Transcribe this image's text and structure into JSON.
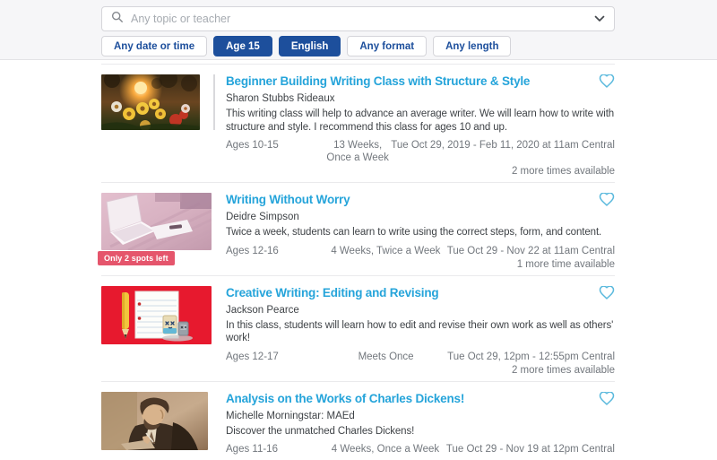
{
  "colors": {
    "accent_blue": "#1d4f9c",
    "title_blue": "#25a4da",
    "heart_blue": "#5ab9dd",
    "badge_red": "#e5556c",
    "text_dark": "#3f4347",
    "text_gray": "#72777d",
    "topbar_bg": "#f6f6f8"
  },
  "search": {
    "placeholder": "Any topic or teacher"
  },
  "filters": [
    {
      "label": "Any date or time",
      "active": false
    },
    {
      "label": "Age 15",
      "active": true
    },
    {
      "label": "English",
      "active": true
    },
    {
      "label": "Any format",
      "active": false
    },
    {
      "label": "Any length",
      "active": false
    }
  ],
  "classes": [
    {
      "title": "Beginner Building Writing Class with Structure & Style",
      "teacher": "Sharon Stubbs Rideaux",
      "description": "This writing class will help to advance an average writer. We will learn how to write with structure and style. I recommend this class for ages 10 and up.",
      "ages": "Ages 10-15",
      "frequency": "13 Weeks, Once a Week",
      "time": "Tue Oct 29, 2019 - Feb 11, 2020 at 11am Central",
      "more": "2 more times available",
      "badge": ""
    },
    {
      "title": "Writing Without Worry",
      "teacher": "Deidre Simpson",
      "description": "Twice a week, students can learn to write using the correct steps, form, and content.",
      "ages": "Ages 12-16",
      "frequency": "4 Weeks, Twice a Week",
      "time": "Tue Oct 29 - Nov 22 at 11am Central",
      "more": "1 more time available",
      "badge": "Only 2 spots left"
    },
    {
      "title": "Creative Writing: Editing and Revising",
      "teacher": "Jackson Pearce",
      "description": "In this class, students will learn how to edit and revise their own work as well as others' work!",
      "ages": "Ages 12-17",
      "frequency": "Meets Once",
      "time": "Tue Oct 29, 12pm - 12:55pm Central",
      "more": "2 more times available",
      "badge": ""
    },
    {
      "title": "Analysis on the Works of Charles Dickens!",
      "teacher": "Michelle Morningstar: MAEd",
      "description": "Discover the unmatched Charles Dickens!",
      "ages": "Ages 11-16",
      "frequency": "4 Weeks, Once a Week",
      "time": "Tue Oct 29 - Nov 19 at 12pm Central",
      "more": "",
      "badge": ""
    }
  ]
}
